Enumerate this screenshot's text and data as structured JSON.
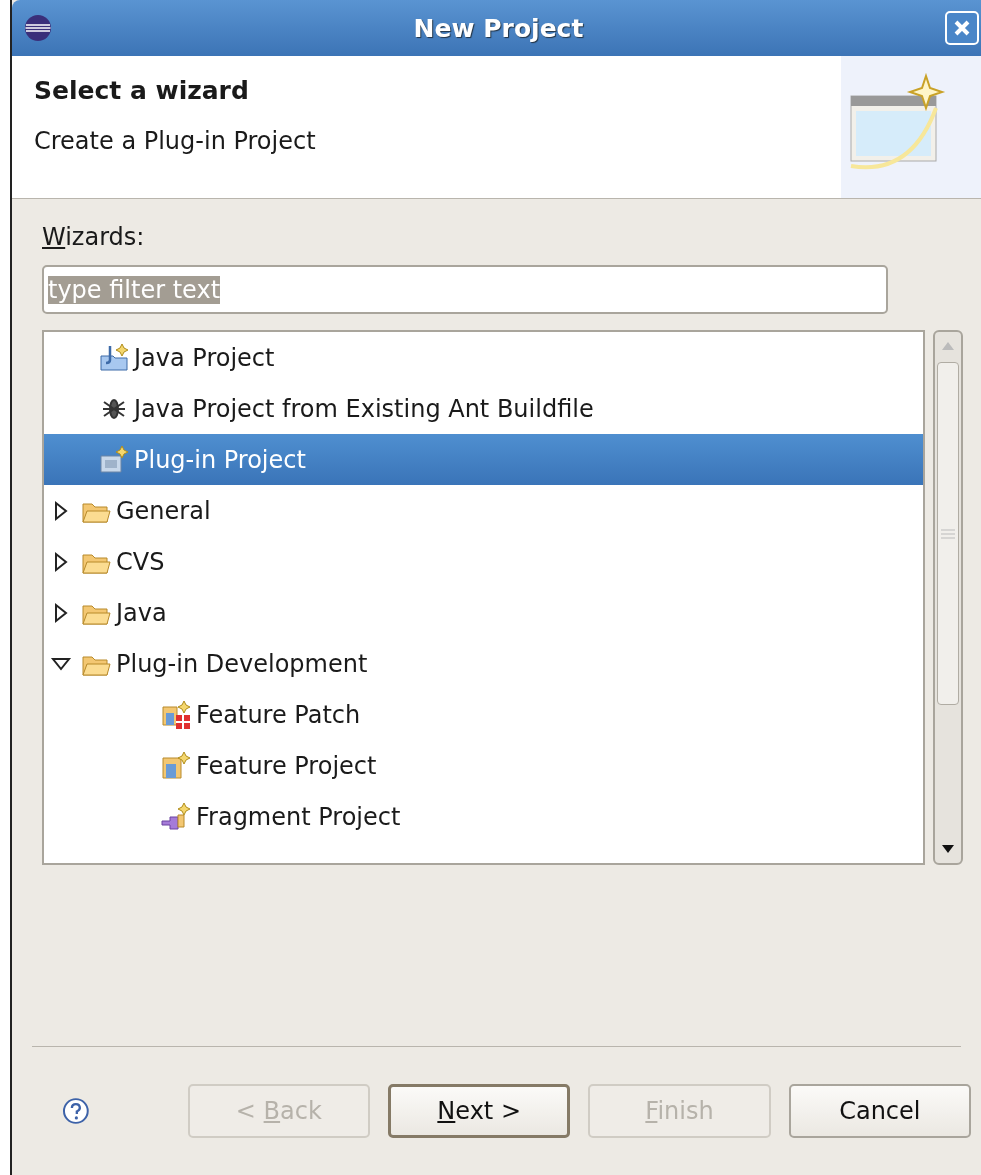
{
  "window": {
    "title": "New Project"
  },
  "header": {
    "title": "Select a wizard",
    "description": "Create a Plug-in Project"
  },
  "wizards_label": {
    "mnemonic": "W",
    "text_after": "izards:"
  },
  "filter": {
    "value": "type filter text",
    "selected": true
  },
  "tree": [
    {
      "label": "Java Project",
      "kind": "project",
      "selected": false
    },
    {
      "label": "Java Project from Existing Ant Buildfile",
      "kind": "ant",
      "selected": false
    },
    {
      "label": "Plug-in Project",
      "kind": "plugin",
      "selected": true
    },
    {
      "label": "General",
      "kind": "folder",
      "selected": false,
      "expanded": false
    },
    {
      "label": "CVS",
      "kind": "folder",
      "selected": false,
      "expanded": false
    },
    {
      "label": "Java",
      "kind": "folder",
      "selected": false,
      "expanded": false
    },
    {
      "label": "Plug-in Development",
      "kind": "folder",
      "selected": false,
      "expanded": true,
      "children": [
        {
          "label": "Feature Patch",
          "kind": "patch",
          "selected": false
        },
        {
          "label": "Feature Project",
          "kind": "feature",
          "selected": false
        },
        {
          "label": "Fragment Project",
          "kind": "fragment",
          "selected": false
        }
      ]
    }
  ],
  "buttons": [
    {
      "text_before": "< ",
      "mnemonic": "B",
      "text_after": "ack",
      "disabled": true,
      "default": false
    },
    {
      "mnemonic": "N",
      "text_after": "ext >",
      "disabled": false,
      "default": true
    },
    {
      "mnemonic": "F",
      "text_after": "inish",
      "disabled": true,
      "default": false
    },
    {
      "text_before": "Cancel",
      "disabled": false,
      "default": false
    }
  ]
}
